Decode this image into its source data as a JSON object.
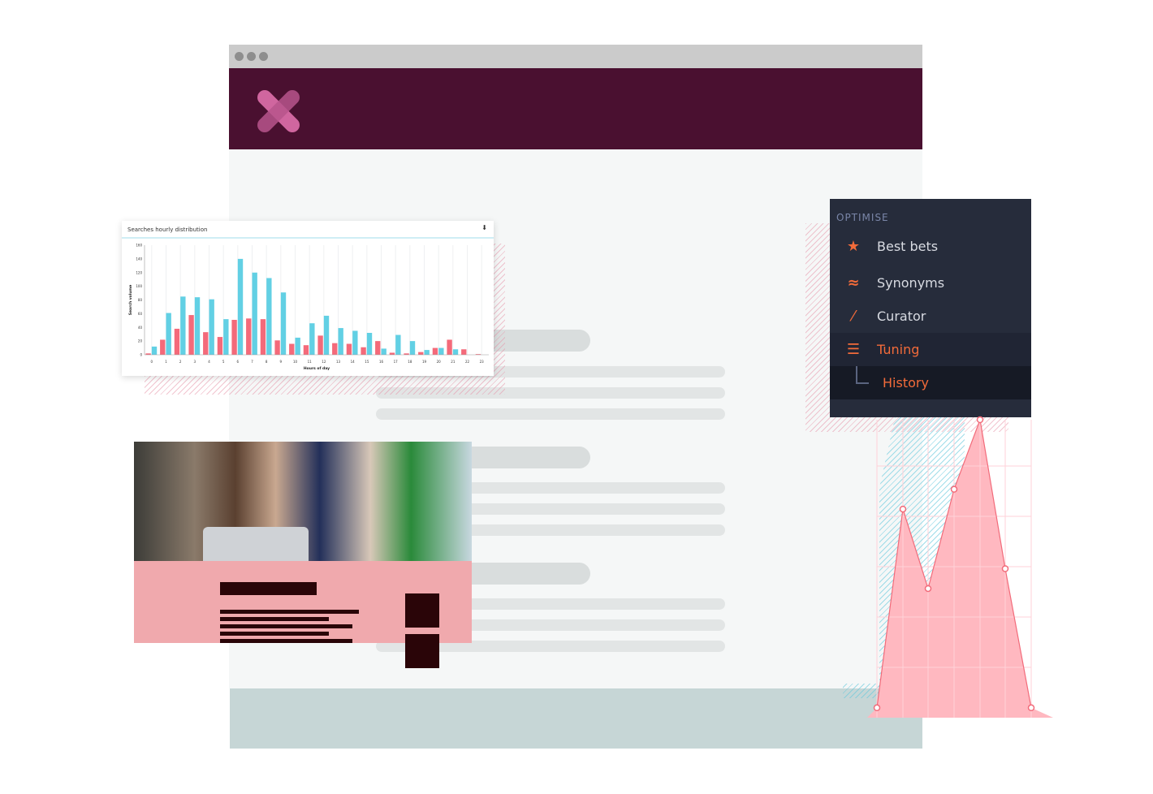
{
  "browser": {
    "dots": 3
  },
  "brand": {
    "logo": "x-logo",
    "color": "#4a1030",
    "logo_color": "#d0669f"
  },
  "menu": {
    "section": "OPTIMISE",
    "items": [
      {
        "label": "Best bets",
        "icon": "star-icon",
        "active": false
      },
      {
        "label": "Synonyms",
        "icon": "approx-icon",
        "active": false
      },
      {
        "label": "Curator",
        "icon": "magic-wand-icon",
        "active": false
      },
      {
        "label": "Tuning",
        "icon": "sliders-icon",
        "active": true
      },
      {
        "label": "History",
        "icon": "tree-branch-icon",
        "active": true,
        "sub": true
      }
    ],
    "accent": "#f26b3a"
  },
  "chart_data": [
    {
      "type": "bar",
      "title": "Searches hourly distribution",
      "xlabel": "Hours of day",
      "ylabel": "Search volume",
      "ylim": [
        0,
        160
      ],
      "yticks": [
        0,
        20,
        40,
        60,
        80,
        100,
        120,
        140,
        160
      ],
      "categories": [
        "0",
        "1",
        "2",
        "3",
        "4",
        "5",
        "6",
        "7",
        "8",
        "9",
        "10",
        "11",
        "12",
        "13",
        "14",
        "15",
        "16",
        "17",
        "18",
        "19",
        "20",
        "21",
        "22",
        "23"
      ],
      "series": [
        {
          "color": "#f46a7a",
          "values": [
            2,
            22,
            38,
            58,
            33,
            26,
            51,
            53,
            52,
            21,
            16,
            14,
            28,
            17,
            16,
            11,
            20,
            3,
            2,
            4,
            10,
            22,
            8,
            1
          ]
        },
        {
          "color": "#62d0e4",
          "values": [
            12,
            61,
            85,
            84,
            81,
            52,
            140,
            120,
            112,
            91,
            25,
            46,
            57,
            39,
            35,
            32,
            9,
            29,
            20,
            7,
            10,
            8,
            0,
            0
          ]
        }
      ],
      "grid": true
    },
    {
      "type": "area",
      "values": [
        1,
        21,
        13,
        23,
        30,
        15,
        1
      ],
      "color": "#ffb8c0",
      "line_color": "#f26b7a",
      "grid": true
    }
  ]
}
